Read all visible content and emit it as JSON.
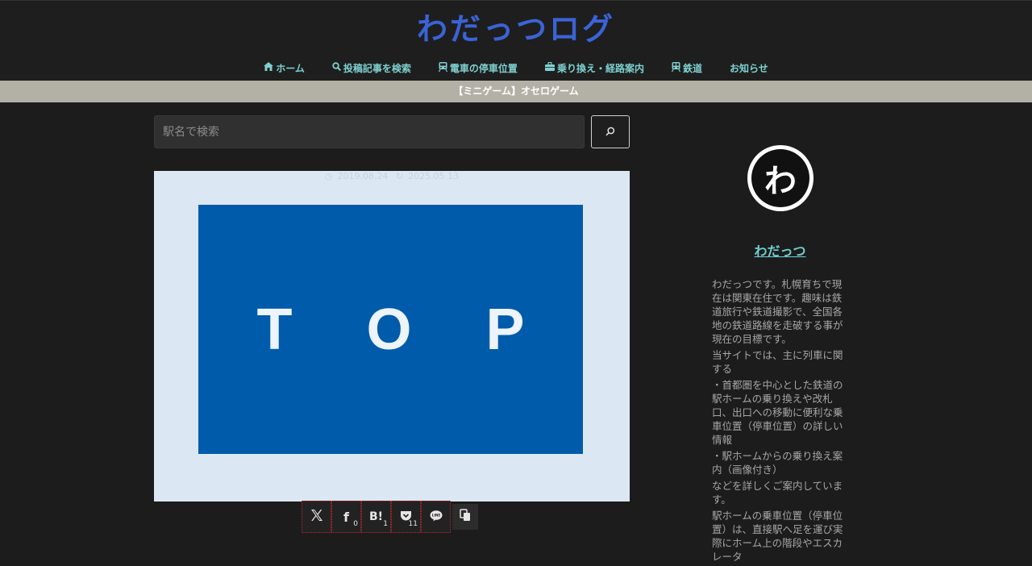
{
  "header": {
    "site_title": "わだっつログ",
    "title_color": "#3a63d6",
    "nav": [
      {
        "label": "ホーム",
        "icon": "home-icon"
      },
      {
        "label": "投稿記事を検索",
        "icon": "search-icon"
      },
      {
        "label": "電車の停車位置",
        "icon": "train-icon"
      },
      {
        "label": "乗り換え・経路案内",
        "icon": "briefcase-icon"
      },
      {
        "label": "鉄道",
        "icon": "subway-icon"
      },
      {
        "label": "お知らせ",
        "icon": ""
      }
    ]
  },
  "notice": {
    "text": "【ミニゲーム】オセロゲーム"
  },
  "search": {
    "placeholder": "駅名で検索"
  },
  "post": {
    "published": "2019.08.24",
    "updated": "2025.05.13",
    "eyecatch_letters": [
      "T",
      "O",
      "P"
    ]
  },
  "share": {
    "buttons": [
      {
        "name": "x",
        "glyph": "𝕏",
        "count": ""
      },
      {
        "name": "facebook",
        "glyph": "f",
        "count": "0"
      },
      {
        "name": "hatena",
        "glyph": "B!",
        "count": "1"
      },
      {
        "name": "pocket",
        "glyph": "pocket",
        "count": "11"
      },
      {
        "name": "line",
        "glyph": "LINE",
        "count": ""
      }
    ]
  },
  "sidebar": {
    "avatar_char": "わ",
    "author_name": "わだっつ",
    "bio": [
      "わだっつです。札幌育ちで現在は関東在住です。趣味は鉄道旅行や鉄道撮影で、全国各地の鉄道路線を走破する事が現在の目標です。",
      "当サイトでは、主に列車に関する",
      "・首都圏を中心とした鉄道の駅ホームの乗り換えや改札口、出口への移動に便利な乗車位置（停車位置）の詳しい情報",
      "・駅ホームからの乗り換え案内（画像付き）",
      "などを詳しくご案内しています。",
      "駅ホームの乗車位置（停車位置）は、直接駅へ足を運び実際にホーム上の階段やエスカレータ"
    ]
  }
}
